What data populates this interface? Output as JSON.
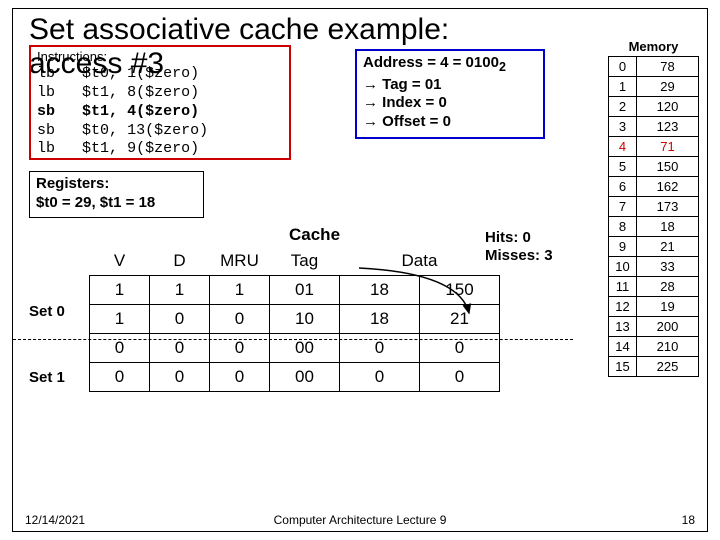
{
  "title": "Set associative cache example:",
  "access_label": "access #3",
  "instructions": {
    "label": "Instructions:",
    "rows": [
      {
        "op": "lb",
        "reg": "$t0,",
        "addr": "1($zero)",
        "bold": false
      },
      {
        "op": "lb",
        "reg": "$t1,",
        "addr": "8($zero)",
        "bold": false
      },
      {
        "op": "sb",
        "reg": "$t1,",
        "addr": "4($zero)",
        "bold": true
      },
      {
        "op": "sb",
        "reg": "$t0,",
        "addr": "13($zero)",
        "bold": false
      },
      {
        "op": "lb",
        "reg": "$t1,",
        "addr": "9($zero)",
        "bold": false
      }
    ]
  },
  "address_box": {
    "line1": "Address = 4 = 0100",
    "sub": "2",
    "line2": "→ Tag = 01",
    "line3": "→ Index = 0",
    "line4": "→ Offset = 0"
  },
  "registers": {
    "label": "Registers:",
    "line": "$t0 = 29, $t1 = 18"
  },
  "hits": {
    "label1": "Hits:  0",
    "label2": "Misses: 3"
  },
  "memory": {
    "label": "Memory",
    "rows": [
      {
        "addr": "0",
        "val": "78",
        "hl": false
      },
      {
        "addr": "1",
        "val": "29",
        "hl": false
      },
      {
        "addr": "2",
        "val": "120",
        "hl": false
      },
      {
        "addr": "3",
        "val": "123",
        "hl": false
      },
      {
        "addr": "4",
        "val": "71",
        "hl": true
      },
      {
        "addr": "5",
        "val": "150",
        "hl": false
      },
      {
        "addr": "6",
        "val": "162",
        "hl": false
      },
      {
        "addr": "7",
        "val": "173",
        "hl": false
      },
      {
        "addr": "8",
        "val": "18",
        "hl": false
      },
      {
        "addr": "9",
        "val": "21",
        "hl": false
      },
      {
        "addr": "10",
        "val": "33",
        "hl": false
      },
      {
        "addr": "11",
        "val": "28",
        "hl": false
      },
      {
        "addr": "12",
        "val": "19",
        "hl": false
      },
      {
        "addr": "13",
        "val": "200",
        "hl": false
      },
      {
        "addr": "14",
        "val": "210",
        "hl": false
      },
      {
        "addr": "15",
        "val": "225",
        "hl": false
      }
    ]
  },
  "cache": {
    "label": "Cache",
    "headers": {
      "v": "V",
      "d": "D",
      "mru": "MRU",
      "tag": "Tag",
      "data": "Data"
    },
    "set0_label": "Set 0",
    "set1_label": "Set 1",
    "rows": [
      {
        "v": "1",
        "d": "1",
        "mru": "1",
        "tag": "01",
        "d1": "18",
        "d2": "150"
      },
      {
        "v": "1",
        "d": "0",
        "mru": "0",
        "tag": "10",
        "d1": "18",
        "d2": "21"
      },
      {
        "v": "0",
        "d": "0",
        "mru": "0",
        "tag": "00",
        "d1": "0",
        "d2": "0"
      },
      {
        "v": "0",
        "d": "0",
        "mru": "0",
        "tag": "00",
        "d1": "0",
        "d2": "0"
      }
    ]
  },
  "footer": {
    "date": "12/14/2021",
    "lecture": "Computer Architecture Lecture 9",
    "page": "18"
  }
}
